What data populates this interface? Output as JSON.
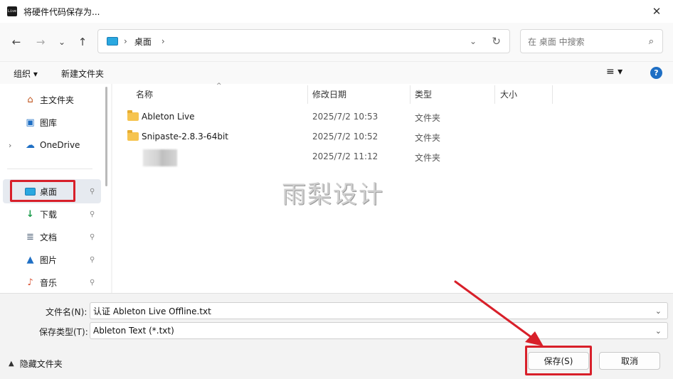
{
  "window": {
    "title": "将硬件代码保存为...",
    "app_icon_text": "Live",
    "close_glyph": "✕"
  },
  "nav": {
    "back": "←",
    "forward": "→",
    "recent": "⌄",
    "up": "↑",
    "address": {
      "separator": "›",
      "crumb": "桌面",
      "crumb_sep": "›",
      "dropdown": "⌄",
      "refresh": "↻"
    },
    "search": {
      "placeholder": "在 桌面 中搜索",
      "icon": "⌕"
    }
  },
  "toolbar": {
    "organize_label": "组织 ▾",
    "new_folder_label": "新建文件夹",
    "view_icon": "≡ ▾",
    "help": "?"
  },
  "sidebar": {
    "items": [
      {
        "label": "主文件夹",
        "icon": "home-icon",
        "glyph": "⌂"
      },
      {
        "label": "图库",
        "icon": "gallery-icon",
        "glyph": "▣"
      },
      {
        "label": "OneDrive",
        "icon": "cloud-icon",
        "glyph": "☁",
        "expand": "›"
      },
      {
        "label": "桌面",
        "icon": "desktop-icon",
        "glyph": "",
        "pin": "⚲"
      },
      {
        "label": "下载",
        "icon": "download-icon",
        "glyph": "↓",
        "pin": "⚲"
      },
      {
        "label": "文档",
        "icon": "document-icon",
        "glyph": "≣",
        "pin": "⚲"
      },
      {
        "label": "图片",
        "icon": "picture-icon",
        "glyph": "▲",
        "pin": "⚲"
      },
      {
        "label": "音乐",
        "icon": "music-icon",
        "glyph": "♪",
        "pin": "⚲"
      }
    ]
  },
  "files": {
    "columns": [
      "名称",
      "修改日期",
      "类型",
      "大小"
    ],
    "sort_indicator": "^",
    "rows": [
      {
        "name": "Ableton Live",
        "date": "2025/7/2 10:53",
        "type": "文件夹"
      },
      {
        "name": "Snipaste-2.8.3-64bit",
        "date": "2025/7/2 10:52",
        "type": "文件夹"
      },
      {
        "name": "",
        "date": "2025/7/2 11:12",
        "type": "文件夹"
      }
    ]
  },
  "watermark": "雨梨设计",
  "form": {
    "filename_label": "文件名(N):",
    "filename_value": "认证 Ableton Live Offline.txt",
    "filetype_label": "保存类型(T):",
    "filetype_value": "Ableton Text (*.txt)",
    "chevron": "⌄"
  },
  "footer": {
    "hide_folders_arrow": "▲",
    "hide_folders_label": "隐藏文件夹",
    "save_label": "保存(S)",
    "cancel_label": "取消"
  },
  "colors": {
    "highlight": "#d8202a",
    "accent": "#1f6fc4",
    "folder": "#f6c44f"
  }
}
